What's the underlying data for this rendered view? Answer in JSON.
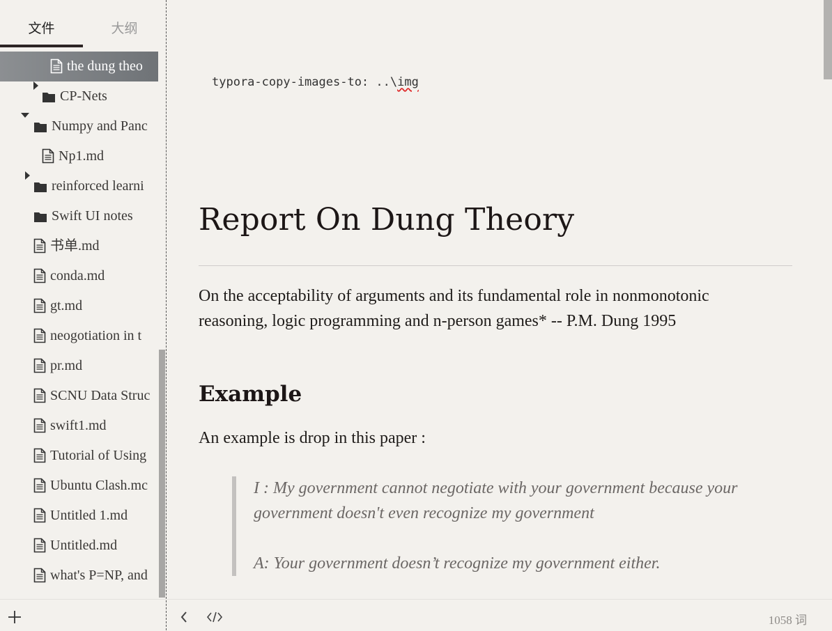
{
  "sidebar": {
    "tabs": [
      {
        "label": "文件",
        "active": true
      },
      {
        "label": "大纲",
        "active": false
      }
    ],
    "tree": [
      {
        "label": "the dung theo",
        "type": "file",
        "selected": true
      },
      {
        "label": "CP-Nets",
        "type": "folder",
        "state": "collapsed"
      },
      {
        "label": "Numpy and Panc",
        "type": "folder",
        "state": "expanded"
      },
      {
        "label": "Np1.md",
        "type": "file"
      },
      {
        "label": "reinforced learni",
        "type": "folder",
        "state": "collapsed"
      },
      {
        "label": "Swift UI notes",
        "type": "folder",
        "state": "none"
      },
      {
        "label": "书单.md",
        "type": "file"
      },
      {
        "label": "conda.md",
        "type": "file"
      },
      {
        "label": "gt.md",
        "type": "file"
      },
      {
        "label": "neogotiation in t",
        "type": "file"
      },
      {
        "label": "pr.md",
        "type": "file"
      },
      {
        "label": "SCNU Data Struc",
        "type": "file"
      },
      {
        "label": "swift1.md",
        "type": "file"
      },
      {
        "label": "Tutorial of Using",
        "type": "file"
      },
      {
        "label": "Ubuntu Clash.mc",
        "type": "file"
      },
      {
        "label": "Untitled 1.md",
        "type": "file"
      },
      {
        "label": "Untitled.md",
        "type": "file"
      },
      {
        "label": "what's P=NP, and",
        "type": "file"
      }
    ],
    "add_icon": "plus-icon"
  },
  "editor": {
    "frontmatter_key": "typora-copy-images-to: ..\\",
    "frontmatter_value": "img",
    "title": "Report On Dung Theory",
    "intro_line1": "On the acceptability of arguments and its fundamental role in nonmonotonic",
    "intro_line2": "reasoning, logic programming and n-person games*  -- P.M. Dung 1995",
    "section_heading": "Example",
    "example_text": "An example is drop in this paper :",
    "quote": [
      "I : My government cannot negotiate with your government because your",
      "government doesn't even recognize my government",
      "A: Your government doesn’t recognize my government either."
    ]
  },
  "footer": {
    "back_icon": "chevron-left-icon",
    "source_icon": "code-icon",
    "word_count": "1058 词"
  },
  "colors": {
    "background": "#f3f1ed",
    "selected_row": "#7d8084",
    "active_tab_underline": "#2d2525",
    "quote_text": "#6b6765"
  }
}
